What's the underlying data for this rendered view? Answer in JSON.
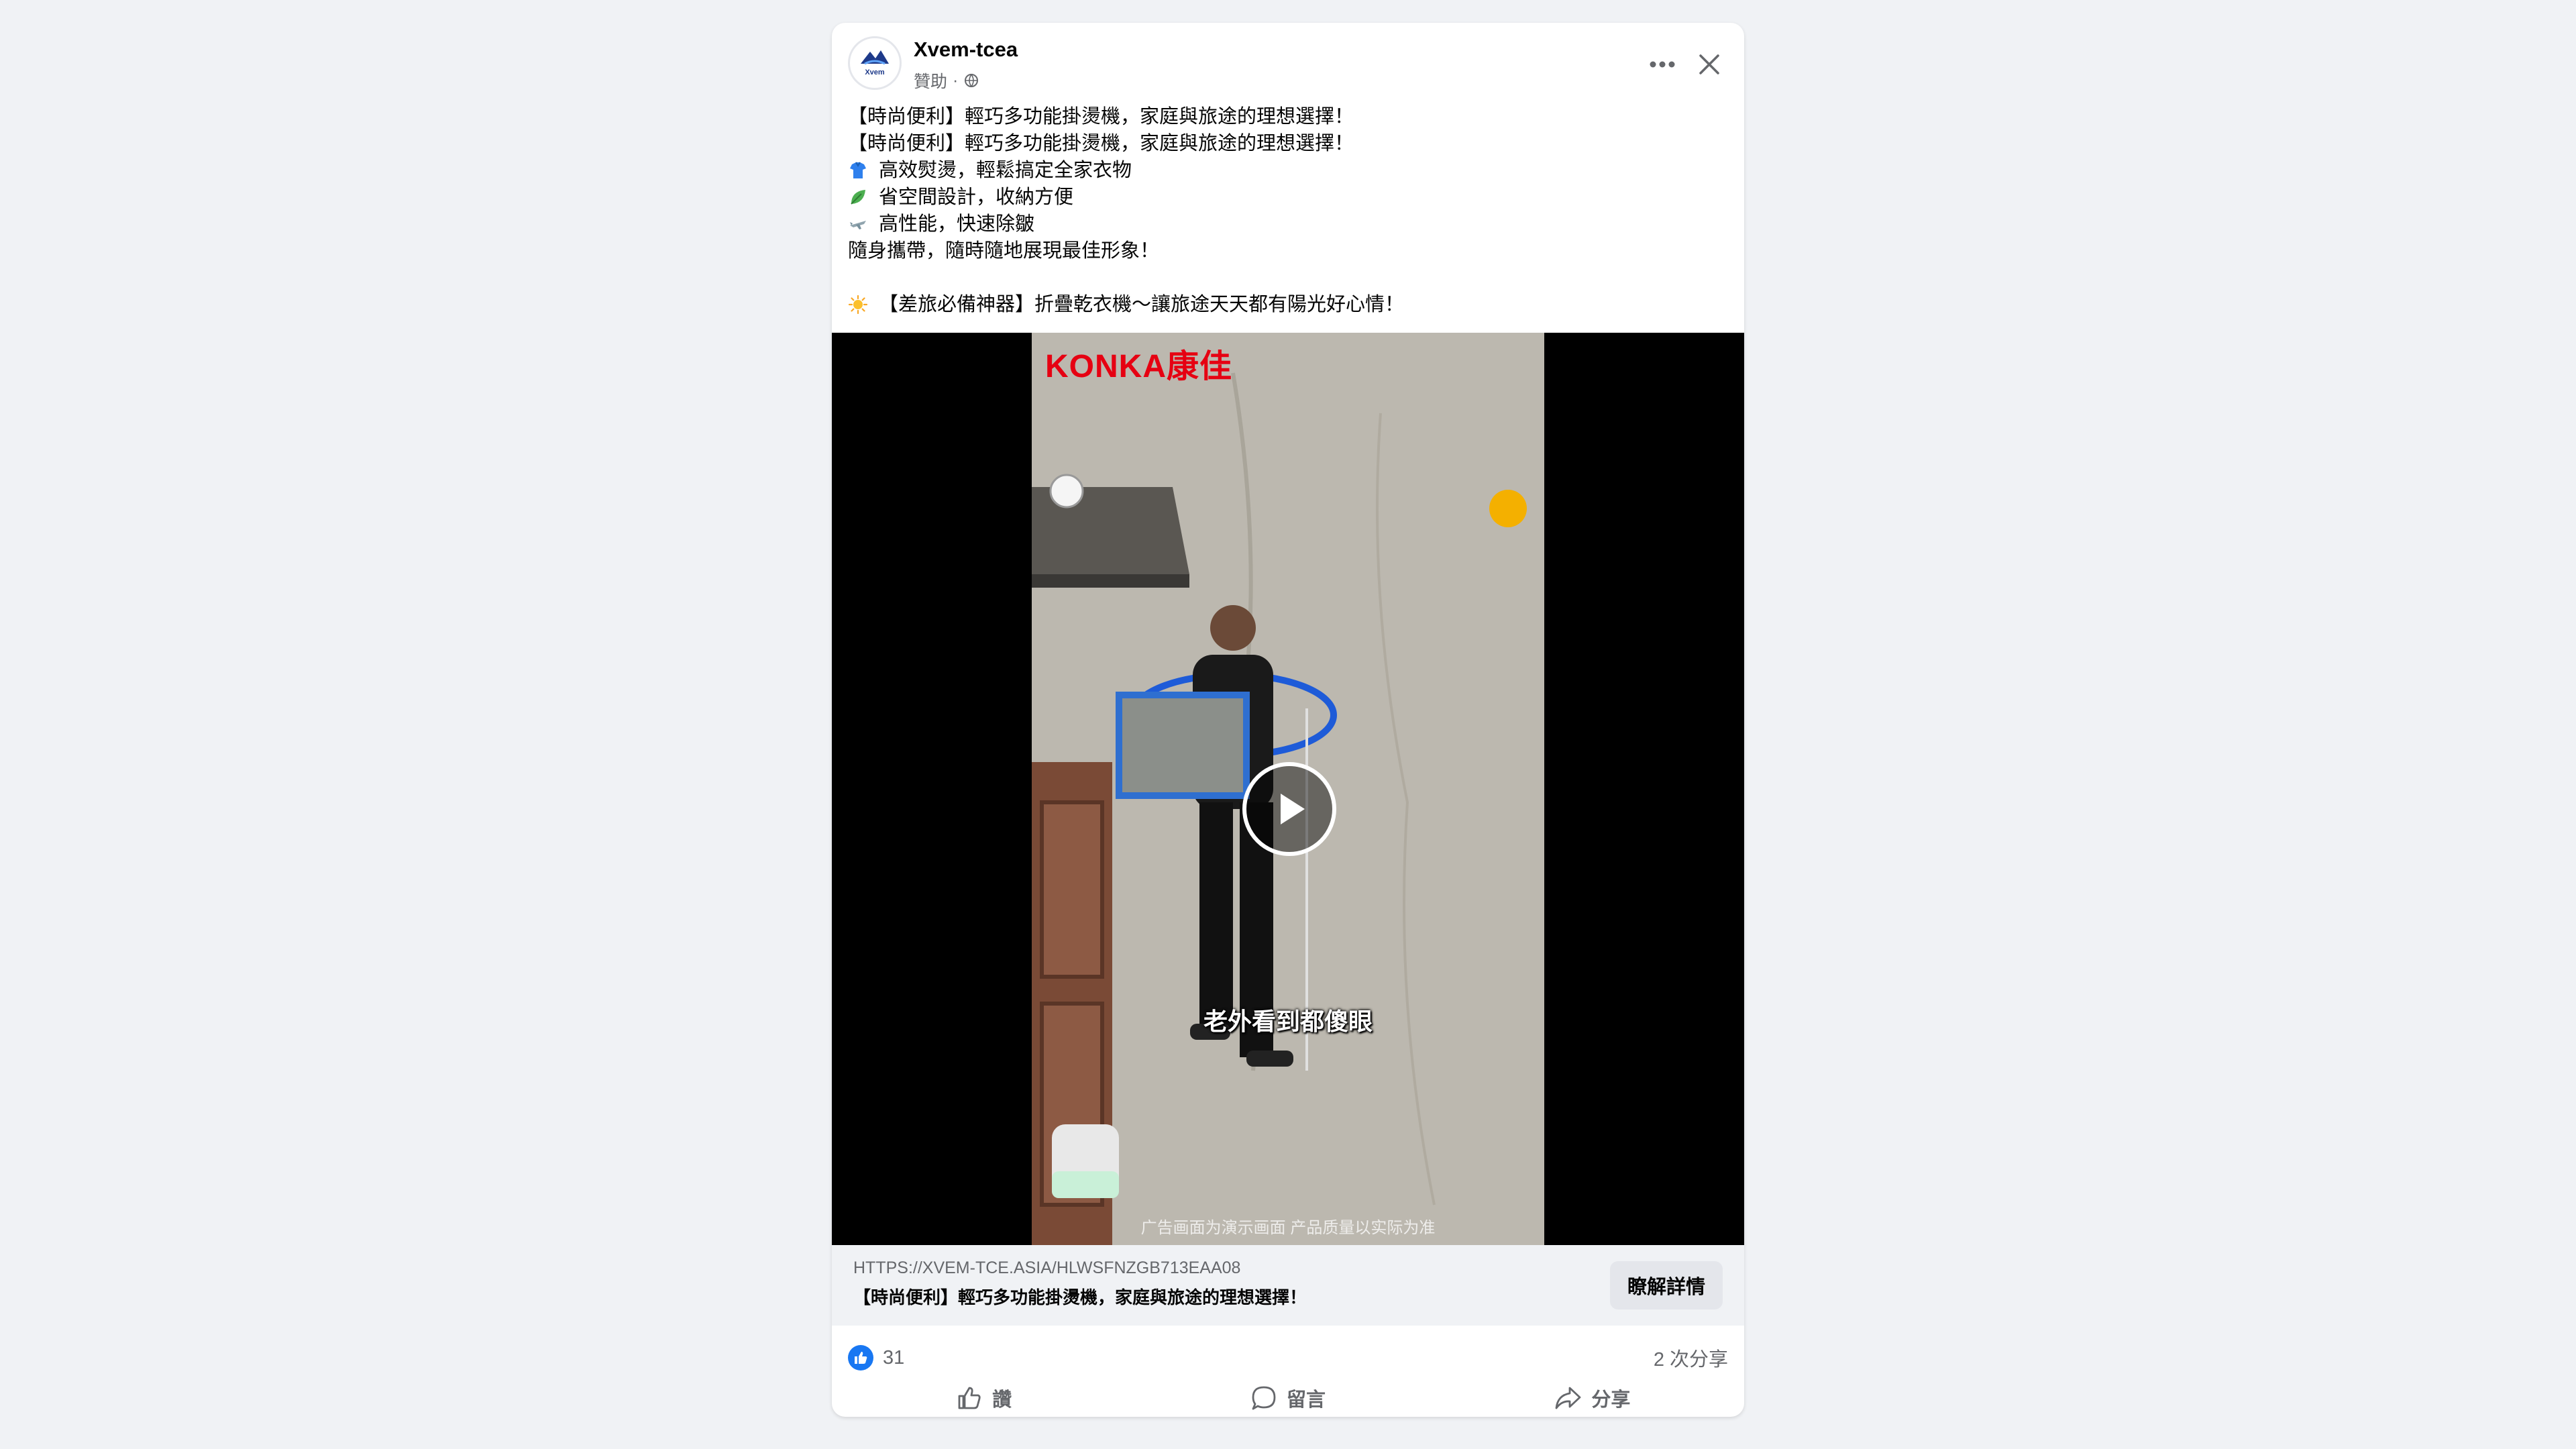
{
  "post": {
    "page_name": "Xvem-tcea",
    "sponsored_label": "贊助",
    "separator": "·",
    "avatar_text": "Xvem",
    "text_lines": [
      {
        "icon": "",
        "text": "【時尚便利】輕巧多功能掛燙機，家庭與旅途的理想選擇！"
      },
      {
        "icon": "",
        "text": "【時尚便利】輕巧多功能掛燙機，家庭與旅途的理想選擇！"
      },
      {
        "icon": "shirt-emoji",
        "text": "高效熨燙，輕鬆搞定全家衣物"
      },
      {
        "icon": "leaf-emoji",
        "text": "省空間設計，收納方便"
      },
      {
        "icon": "plane-emoji",
        "text": "高性能，快速除皺"
      },
      {
        "icon": "",
        "text": "隨身攜帶，隨時隨地展現最佳形象！"
      },
      {
        "icon": "",
        "text": ""
      },
      {
        "icon": "sun-emoji",
        "text": "【差旅必備神器】折疊乾衣機～讓旅途天天都有陽光好心情！"
      }
    ]
  },
  "video": {
    "brand_text": "KONKA康佳",
    "subtitle": "老外看到都傻眼",
    "disclaimer": "广告画面为演示画面  产品质量以实际为准"
  },
  "link": {
    "url": "HTTPS://XVEM-TCE.ASIA/HLWSFNZGB713EAA08",
    "title": "【時尚便利】輕巧多功能掛燙機，家庭與旅途的理想選擇！",
    "cta": "瞭解詳情"
  },
  "stats": {
    "reaction_count": "31",
    "share_count": "2 次分享"
  },
  "actions": {
    "like": "讚",
    "comment": "留言",
    "share": "分享"
  },
  "colors": {
    "accent": "#1877f2",
    "brand_red": "#e60012",
    "secondary_text": "#65676b"
  }
}
